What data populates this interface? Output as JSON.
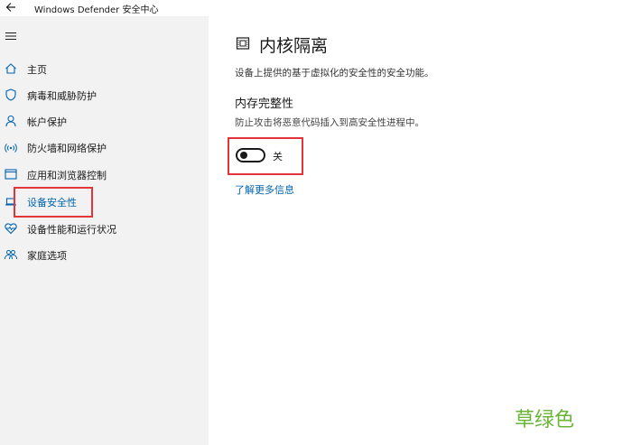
{
  "titlebar": {
    "title": "Windows Defender 安全中心"
  },
  "sidebar": {
    "items": [
      {
        "label": "主页",
        "icon": "home-icon"
      },
      {
        "label": "病毒和威胁防护",
        "icon": "shield-icon"
      },
      {
        "label": "帐户保护",
        "icon": "person-icon"
      },
      {
        "label": "防火墙和网络保护",
        "icon": "wifi-icon"
      },
      {
        "label": "应用和浏览器控制",
        "icon": "browser-window-icon"
      },
      {
        "label": "设备安全性",
        "icon": "laptop-icon",
        "active": true
      },
      {
        "label": "设备性能和运行状况",
        "icon": "heart-icon"
      },
      {
        "label": "家庭选项",
        "icon": "family-icon"
      }
    ]
  },
  "main": {
    "title": "内核隔离",
    "description": "设备上提供的基于虚拟化的安全性的安全功能。",
    "section": {
      "title": "内存完整性",
      "description": "防止攻击将恶意代码插入到高安全性进程中。",
      "toggle_label": "关",
      "toggle_on": false
    },
    "learn_more": "了解更多信息"
  },
  "watermark": "草绿色",
  "colors": {
    "accent": "#0063b1",
    "sidebar_bg": "#f2f2f2",
    "highlight": "#e3343b",
    "watermark": "#6ab437"
  }
}
